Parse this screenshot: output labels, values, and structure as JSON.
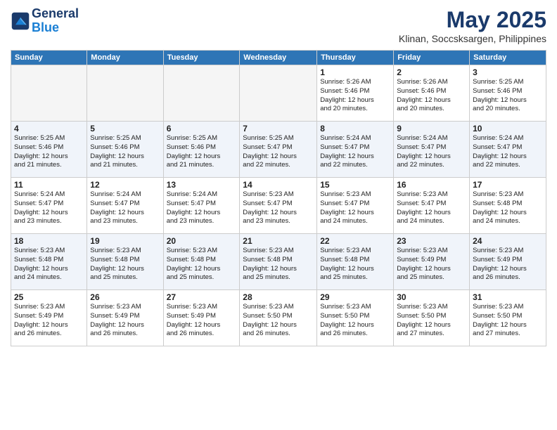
{
  "header": {
    "logo_line1": "General",
    "logo_line2": "Blue",
    "month": "May 2025",
    "location": "Klinan, Soccsksargen, Philippines"
  },
  "weekdays": [
    "Sunday",
    "Monday",
    "Tuesday",
    "Wednesday",
    "Thursday",
    "Friday",
    "Saturday"
  ],
  "weeks": [
    [
      {
        "day": "",
        "info": ""
      },
      {
        "day": "",
        "info": ""
      },
      {
        "day": "",
        "info": ""
      },
      {
        "day": "",
        "info": ""
      },
      {
        "day": "1",
        "info": "Sunrise: 5:26 AM\nSunset: 5:46 PM\nDaylight: 12 hours\nand 20 minutes."
      },
      {
        "day": "2",
        "info": "Sunrise: 5:26 AM\nSunset: 5:46 PM\nDaylight: 12 hours\nand 20 minutes."
      },
      {
        "day": "3",
        "info": "Sunrise: 5:25 AM\nSunset: 5:46 PM\nDaylight: 12 hours\nand 20 minutes."
      }
    ],
    [
      {
        "day": "4",
        "info": "Sunrise: 5:25 AM\nSunset: 5:46 PM\nDaylight: 12 hours\nand 21 minutes."
      },
      {
        "day": "5",
        "info": "Sunrise: 5:25 AM\nSunset: 5:46 PM\nDaylight: 12 hours\nand 21 minutes."
      },
      {
        "day": "6",
        "info": "Sunrise: 5:25 AM\nSunset: 5:46 PM\nDaylight: 12 hours\nand 21 minutes."
      },
      {
        "day": "7",
        "info": "Sunrise: 5:25 AM\nSunset: 5:47 PM\nDaylight: 12 hours\nand 22 minutes."
      },
      {
        "day": "8",
        "info": "Sunrise: 5:24 AM\nSunset: 5:47 PM\nDaylight: 12 hours\nand 22 minutes."
      },
      {
        "day": "9",
        "info": "Sunrise: 5:24 AM\nSunset: 5:47 PM\nDaylight: 12 hours\nand 22 minutes."
      },
      {
        "day": "10",
        "info": "Sunrise: 5:24 AM\nSunset: 5:47 PM\nDaylight: 12 hours\nand 22 minutes."
      }
    ],
    [
      {
        "day": "11",
        "info": "Sunrise: 5:24 AM\nSunset: 5:47 PM\nDaylight: 12 hours\nand 23 minutes."
      },
      {
        "day": "12",
        "info": "Sunrise: 5:24 AM\nSunset: 5:47 PM\nDaylight: 12 hours\nand 23 minutes."
      },
      {
        "day": "13",
        "info": "Sunrise: 5:24 AM\nSunset: 5:47 PM\nDaylight: 12 hours\nand 23 minutes."
      },
      {
        "day": "14",
        "info": "Sunrise: 5:23 AM\nSunset: 5:47 PM\nDaylight: 12 hours\nand 23 minutes."
      },
      {
        "day": "15",
        "info": "Sunrise: 5:23 AM\nSunset: 5:47 PM\nDaylight: 12 hours\nand 24 minutes."
      },
      {
        "day": "16",
        "info": "Sunrise: 5:23 AM\nSunset: 5:47 PM\nDaylight: 12 hours\nand 24 minutes."
      },
      {
        "day": "17",
        "info": "Sunrise: 5:23 AM\nSunset: 5:48 PM\nDaylight: 12 hours\nand 24 minutes."
      }
    ],
    [
      {
        "day": "18",
        "info": "Sunrise: 5:23 AM\nSunset: 5:48 PM\nDaylight: 12 hours\nand 24 minutes."
      },
      {
        "day": "19",
        "info": "Sunrise: 5:23 AM\nSunset: 5:48 PM\nDaylight: 12 hours\nand 25 minutes."
      },
      {
        "day": "20",
        "info": "Sunrise: 5:23 AM\nSunset: 5:48 PM\nDaylight: 12 hours\nand 25 minutes."
      },
      {
        "day": "21",
        "info": "Sunrise: 5:23 AM\nSunset: 5:48 PM\nDaylight: 12 hours\nand 25 minutes."
      },
      {
        "day": "22",
        "info": "Sunrise: 5:23 AM\nSunset: 5:48 PM\nDaylight: 12 hours\nand 25 minutes."
      },
      {
        "day": "23",
        "info": "Sunrise: 5:23 AM\nSunset: 5:49 PM\nDaylight: 12 hours\nand 25 minutes."
      },
      {
        "day": "24",
        "info": "Sunrise: 5:23 AM\nSunset: 5:49 PM\nDaylight: 12 hours\nand 26 minutes."
      }
    ],
    [
      {
        "day": "25",
        "info": "Sunrise: 5:23 AM\nSunset: 5:49 PM\nDaylight: 12 hours\nand 26 minutes."
      },
      {
        "day": "26",
        "info": "Sunrise: 5:23 AM\nSunset: 5:49 PM\nDaylight: 12 hours\nand 26 minutes."
      },
      {
        "day": "27",
        "info": "Sunrise: 5:23 AM\nSunset: 5:49 PM\nDaylight: 12 hours\nand 26 minutes."
      },
      {
        "day": "28",
        "info": "Sunrise: 5:23 AM\nSunset: 5:50 PM\nDaylight: 12 hours\nand 26 minutes."
      },
      {
        "day": "29",
        "info": "Sunrise: 5:23 AM\nSunset: 5:50 PM\nDaylight: 12 hours\nand 26 minutes."
      },
      {
        "day": "30",
        "info": "Sunrise: 5:23 AM\nSunset: 5:50 PM\nDaylight: 12 hours\nand 27 minutes."
      },
      {
        "day": "31",
        "info": "Sunrise: 5:23 AM\nSunset: 5:50 PM\nDaylight: 12 hours\nand 27 minutes."
      }
    ]
  ]
}
